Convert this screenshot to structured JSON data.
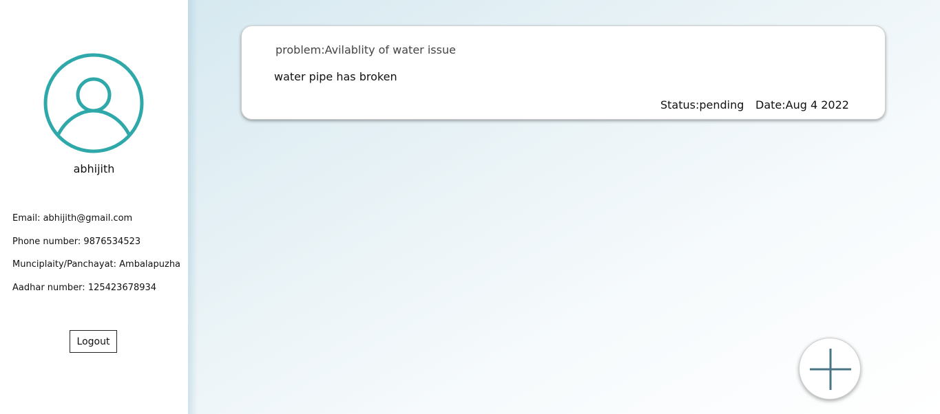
{
  "profile": {
    "username": "abhijith",
    "email_line": "Email: abhijith@gmail.com",
    "phone_line": "Phone number: 9876534523",
    "municipality_line": "Munciplaity/Panchayat: Ambalapuzha",
    "aadhar_line": "Aadhar number: 125423678934",
    "logout_label": "Logout",
    "avatar_icon": "user-circle-icon"
  },
  "complaints": [
    {
      "problem": "problem:Avilablity of water issue",
      "description": "water pipe has broken",
      "status": "Status:pending",
      "date": "Date:Aug 4 2022"
    }
  ],
  "actions": {
    "add_icon": "plus-icon"
  },
  "colors": {
    "avatar_accent": "#2ea8a8",
    "plus_stroke": "#4a7585",
    "main_bg_start": "#d6e9f0",
    "main_bg_end": "#ffffff"
  }
}
